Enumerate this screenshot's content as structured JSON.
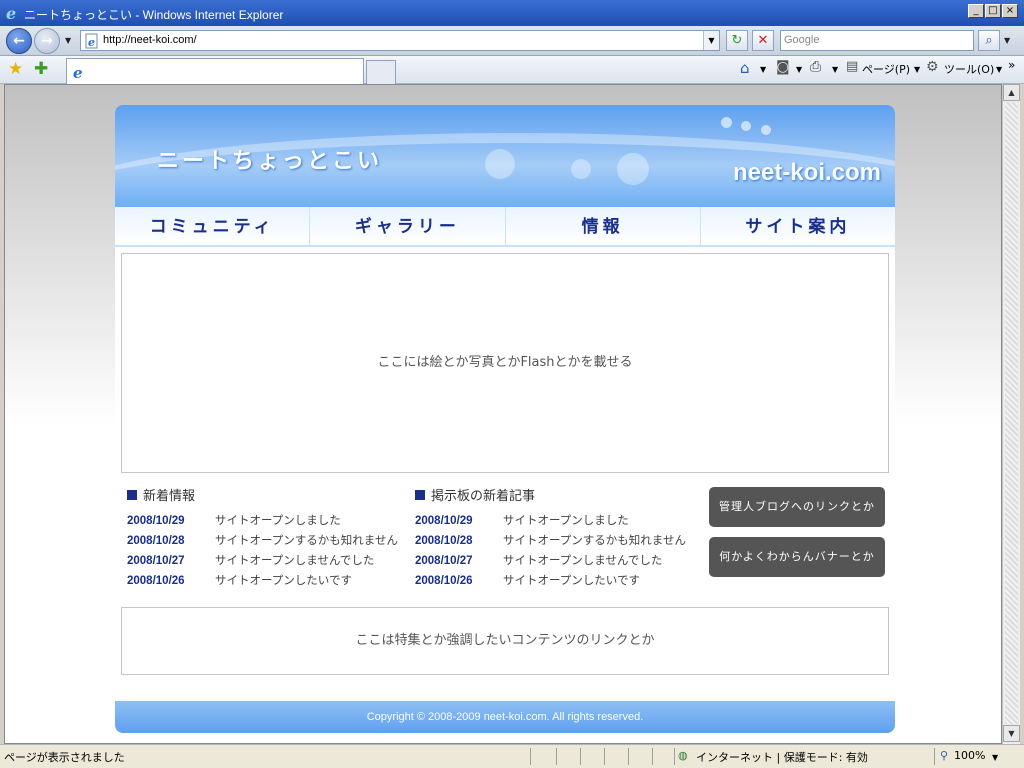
{
  "window": {
    "title": "ニートちょっとこい - Windows Internet Explorer"
  },
  "address_bar": {
    "url": "http://neet-koi.com/",
    "search_placeholder": "Google"
  },
  "command_bar": {
    "page_label": "ページ(P)",
    "tools_label": "ツール(O)"
  },
  "site": {
    "logo_jp": "ニートちょっとこい",
    "logo_en": "neet-koi.com",
    "nav": [
      "コミュニティ",
      "ギャラリー",
      "情報",
      "サイト案内"
    ],
    "hero_text": "ここには絵とか写真とかFlashとかを載せる",
    "news": {
      "title": "新着情報",
      "items": [
        {
          "date": "2008/10/29",
          "text": "サイトオープンしました"
        },
        {
          "date": "2008/10/28",
          "text": "サイトオープンするかも知れません"
        },
        {
          "date": "2008/10/27",
          "text": "サイトオープンしませんでした"
        },
        {
          "date": "2008/10/26",
          "text": "サイトオープンしたいです"
        }
      ]
    },
    "board": {
      "title": "掲示板の新着記事",
      "items": [
        {
          "date": "2008/10/29",
          "text": "サイトオープンしました"
        },
        {
          "date": "2008/10/28",
          "text": "サイトオープンするかも知れません"
        },
        {
          "date": "2008/10/27",
          "text": "サイトオープンしませんでした"
        },
        {
          "date": "2008/10/26",
          "text": "サイトオープンしたいです"
        }
      ]
    },
    "banners": [
      "管理人ブログへのリンクとか",
      "何かよくわからんバナーとか"
    ],
    "feature_text": "ここは特集とか強調したいコンテンツのリンクとか",
    "footer": "Copyright © 2008-2009 neet-koi.com. All rights reserved."
  },
  "status_bar": {
    "status": "ページが表示されました",
    "zone": "インターネット | 保護モード: 有効",
    "zoom": "100%"
  },
  "colors": {
    "accent": "#1a2f8a",
    "header_blue": "#5ea0ef",
    "banner_gray": "#555555"
  }
}
